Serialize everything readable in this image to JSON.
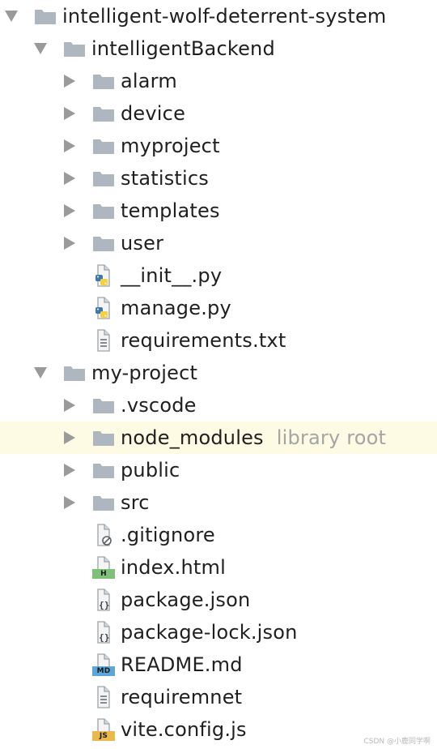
{
  "tree": {
    "items": [
      {
        "label": "intelligent-wolf-deterrent-system",
        "type": "folder",
        "depth": 0,
        "state": "open"
      },
      {
        "label": "intelligentBackend",
        "type": "folder",
        "depth": 1,
        "state": "open"
      },
      {
        "label": "alarm",
        "type": "folder",
        "depth": 2,
        "state": "closed"
      },
      {
        "label": "device",
        "type": "folder",
        "depth": 2,
        "state": "closed"
      },
      {
        "label": "myproject",
        "type": "folder",
        "depth": 2,
        "state": "closed"
      },
      {
        "label": "statistics",
        "type": "folder",
        "depth": 2,
        "state": "closed"
      },
      {
        "label": "templates",
        "type": "folder",
        "depth": 2,
        "state": "closed"
      },
      {
        "label": "user",
        "type": "folder",
        "depth": 2,
        "state": "closed"
      },
      {
        "label": "__init__.py",
        "type": "python",
        "depth": 2
      },
      {
        "label": "manage.py",
        "type": "python",
        "depth": 2
      },
      {
        "label": "requirements.txt",
        "type": "text",
        "depth": 2
      },
      {
        "label": "my-project",
        "type": "folder",
        "depth": 1,
        "state": "open"
      },
      {
        "label": ".vscode",
        "type": "folder",
        "depth": 2,
        "state": "closed"
      },
      {
        "label": "node_modules",
        "type": "folder",
        "depth": 2,
        "state": "closed",
        "hint": "library root",
        "highlight": true
      },
      {
        "label": "public",
        "type": "folder",
        "depth": 2,
        "state": "closed"
      },
      {
        "label": "src",
        "type": "folder",
        "depth": 2,
        "state": "closed"
      },
      {
        "label": ".gitignore",
        "type": "ignore",
        "depth": 2
      },
      {
        "label": "index.html",
        "type": "html",
        "badge": "H",
        "depth": 2
      },
      {
        "label": "package.json",
        "type": "json",
        "depth": 2
      },
      {
        "label": "package-lock.json",
        "type": "json",
        "depth": 2
      },
      {
        "label": "README.md",
        "type": "markdown",
        "badge": "MD",
        "depth": 2
      },
      {
        "label": "requiremnet",
        "type": "text",
        "depth": 2
      },
      {
        "label": "vite.config.js",
        "type": "javascript",
        "badge": "JS",
        "depth": 2
      }
    ]
  },
  "watermark": "CSDN @小鹿同学啊",
  "colors": {
    "folder": "#aeb7c0",
    "arrow": "#9a9a9a",
    "highlight": "#fdfbe3",
    "html_badge": "#7ec17a",
    "md_badge": "#5aa7d8",
    "js_badge": "#e9b949",
    "python_blue": "#3c78aa",
    "python_yellow": "#f5d041"
  }
}
